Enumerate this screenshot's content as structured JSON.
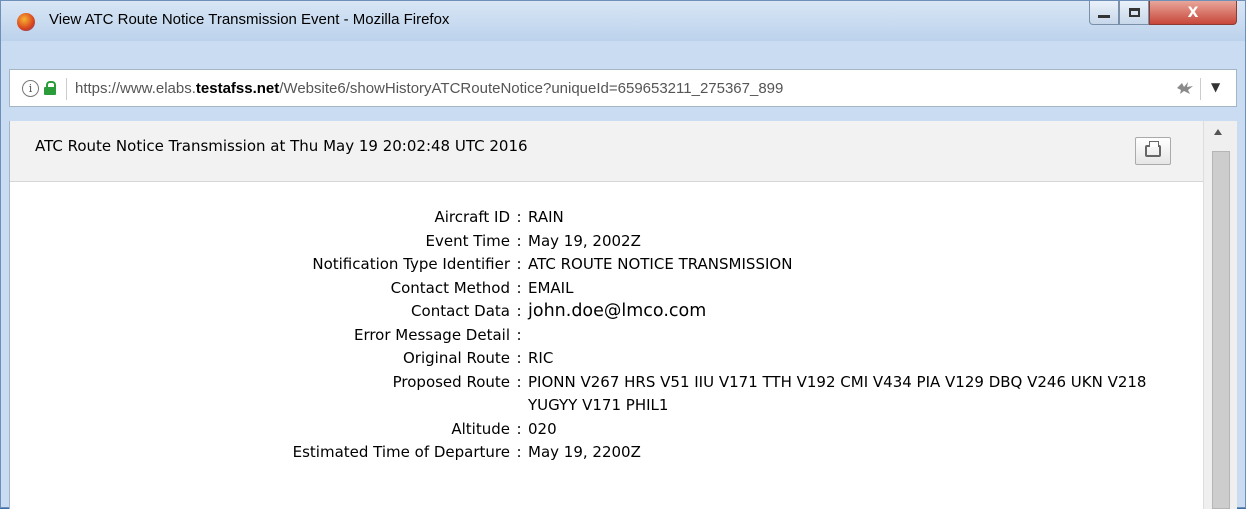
{
  "window": {
    "title": "View ATC Route Notice Transmission Event - Mozilla Firefox",
    "buttons": {
      "minimize": "minimize",
      "maximize": "maximize",
      "close": "X"
    }
  },
  "urlbar": {
    "url_prefix": "https://www.elabs.",
    "url_domain": "testafss.net",
    "url_path": "/Website6/showHistoryATCRouteNotice?uniqueId=659653211_275367_899",
    "info_glyph": "i",
    "dropdown_glyph": "▼"
  },
  "page": {
    "header_title": "ATC Route Notice Transmission at Thu May 19 20:02:48 UTC 2016",
    "separator": ":",
    "fields": [
      {
        "label": "Aircraft ID",
        "value": "RAIN"
      },
      {
        "label": "Event Time",
        "value": "May 19, 2002Z"
      },
      {
        "label": "Notification Type Identifier",
        "value": "ATC ROUTE NOTICE TRANSMISSION"
      },
      {
        "label": "Contact Method",
        "value": "EMAIL"
      },
      {
        "label": "Contact Data",
        "value": "john.doe@lmco.com"
      },
      {
        "label": "Error Message Detail",
        "value": ""
      },
      {
        "label": "Original Route",
        "value": "RIC"
      },
      {
        "label": "Proposed Route",
        "value": "PIONN V267 HRS V51 IIU V171 TTH V192 CMI V434 PIA V129 DBQ V246 UKN V218 YUGYY V171 PHIL1"
      },
      {
        "label": "Altitude",
        "value": "020"
      },
      {
        "label": "Estimated Time of Departure",
        "value": "May 19, 2200Z"
      }
    ]
  },
  "colors": {
    "titlebar": "#c9dcf1",
    "close_button": "#c7473a",
    "lock": "#2a9c3a"
  }
}
